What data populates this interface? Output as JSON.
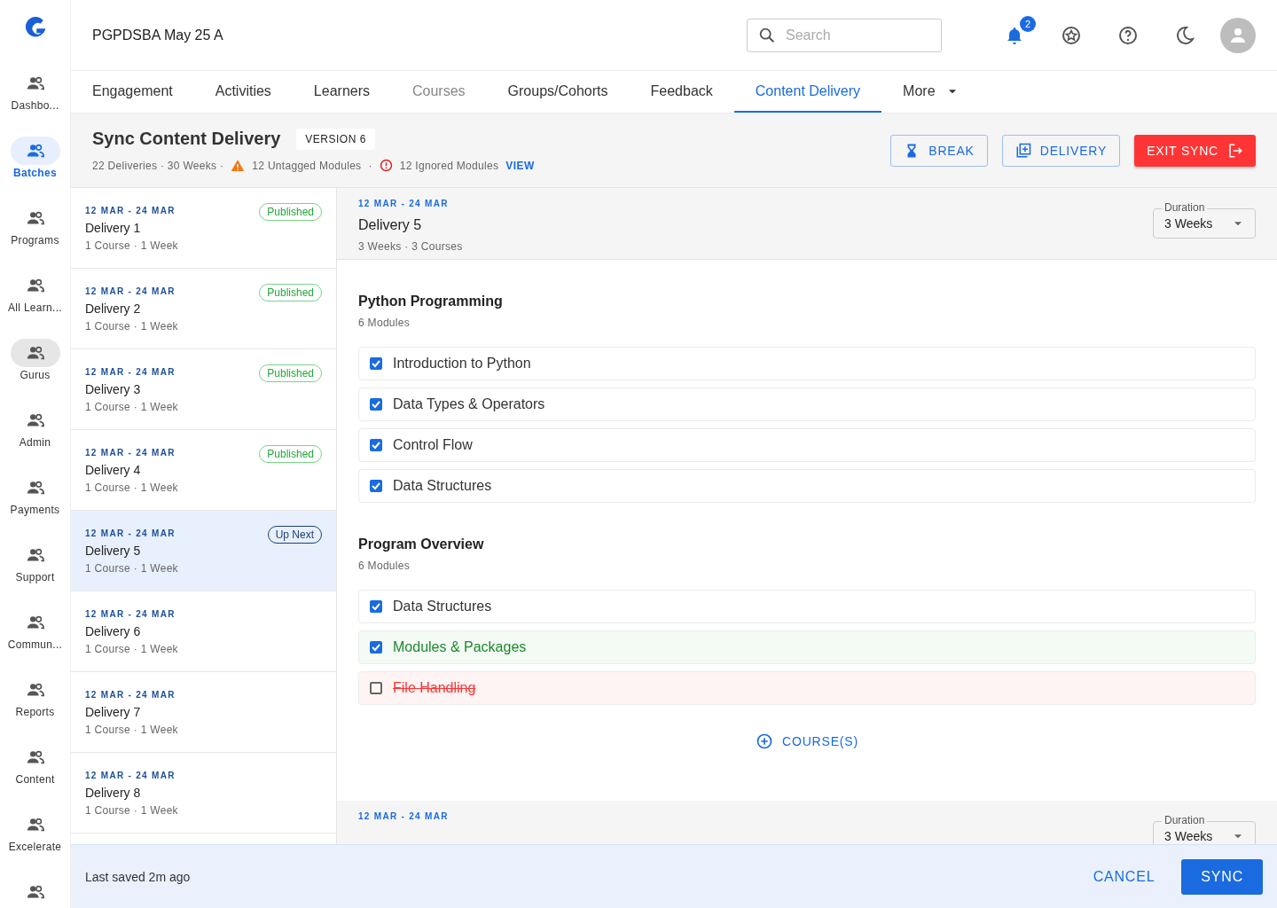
{
  "rail": [
    {
      "label": "Dashbo...",
      "selected": false,
      "hovered": false
    },
    {
      "label": "Batches",
      "selected": true,
      "hovered": false
    },
    {
      "label": "Programs",
      "selected": false,
      "hovered": false
    },
    {
      "label": "All Learn...",
      "selected": false,
      "hovered": false
    },
    {
      "label": "Gurus",
      "selected": false,
      "hovered": true
    },
    {
      "label": "Admin",
      "selected": false,
      "hovered": false
    },
    {
      "label": "Payments",
      "selected": false,
      "hovered": false
    },
    {
      "label": "Support",
      "selected": false,
      "hovered": false
    },
    {
      "label": "Commun...",
      "selected": false,
      "hovered": false
    },
    {
      "label": "Reports",
      "selected": false,
      "hovered": false
    },
    {
      "label": "Content",
      "selected": false,
      "hovered": false
    },
    {
      "label": "Excelerate",
      "selected": false,
      "hovered": false
    },
    {
      "selected": false,
      "hovered": false
    }
  ],
  "header": {
    "title": "PGPDSBA May 25 A",
    "search": {
      "placeholder": "Search"
    },
    "notifications": "2"
  },
  "tabs": [
    {
      "label": "Engagement",
      "selected": false,
      "disabled": false
    },
    {
      "label": "Activities",
      "selected": false,
      "disabled": false
    },
    {
      "label": "Learners",
      "selected": false,
      "disabled": false
    },
    {
      "label": "Courses",
      "selected": false,
      "disabled": true
    },
    {
      "label": "Groups/Cohorts",
      "selected": false,
      "disabled": false
    },
    {
      "label": "Feedback",
      "selected": false,
      "disabled": false
    },
    {
      "label": "Content Delivery",
      "selected": true,
      "disabled": false
    },
    {
      "label": "More",
      "selected": false,
      "disabled": false,
      "kind": "menu"
    }
  ],
  "page": {
    "title": "Sync Content Delivery",
    "version": "VERSION 6",
    "summary": "22 Deliveries · 30 Weeks ·",
    "untagged": "12 Untagged Modules",
    "separator": "·",
    "ignored": "12 Ignored Modules",
    "view": "VIEW",
    "buttons": [
      {
        "label": "BREAK",
        "kind": "break"
      },
      {
        "label": "DELIVERY",
        "kind": "delivery"
      },
      {
        "label": "EXIT SYNC",
        "kind": "exit"
      }
    ]
  },
  "deliveries": [
    {
      "dates": "12 MAR - 24 MAR",
      "name": "Delivery 1",
      "meta": "1 Course · 1 Week",
      "badge": "Published",
      "kind": "published",
      "selected": false
    },
    {
      "dates": "12 MAR - 24 MAR",
      "name": "Delivery 2",
      "meta": "1 Course · 1 Week",
      "badge": "Published",
      "kind": "published",
      "selected": false
    },
    {
      "dates": "12 MAR - 24 MAR",
      "name": "Delivery 3",
      "meta": "1 Course · 1 Week",
      "badge": "Published",
      "kind": "published",
      "selected": false
    },
    {
      "dates": "12 MAR - 24 MAR",
      "name": "Delivery 4",
      "meta": "1 Course · 1 Week",
      "badge": "Published",
      "kind": "published",
      "selected": false
    },
    {
      "dates": "12 MAR - 24 MAR",
      "name": "Delivery 5",
      "meta": "1 Course · 1 Week",
      "badge": "Up Next",
      "kind": "upnext",
      "selected": true
    },
    {
      "dates": "12 MAR - 24 MAR",
      "name": "Delivery 6",
      "meta": "1 Course · 1 Week",
      "selected": false
    },
    {
      "dates": "12 MAR - 24 MAR",
      "name": "Delivery 7",
      "meta": "1 Course · 1 Week",
      "selected": false
    },
    {
      "dates": "12 MAR - 24 MAR",
      "name": "Delivery 8",
      "meta": "1 Course · 1 Week",
      "selected": false
    }
  ],
  "detail": [
    {
      "dates": "12 MAR - 24 MAR",
      "title": "Delivery 5",
      "meta": "3 Weeks · 3 Courses",
      "duration": {
        "label": "Duration",
        "value": "3 Weeks"
      },
      "courses": [
        {
          "title": "Python Programming",
          "count": "6 Modules",
          "modules": [
            {
              "label": "Introduction to Python",
              "checked": true,
              "kind": "plain"
            },
            {
              "label": "Data Types & Operators",
              "checked": true,
              "kind": "plain"
            },
            {
              "label": "Control Flow",
              "checked": true,
              "kind": "plain"
            },
            {
              "label": "Data Structures",
              "checked": true,
              "kind": "plain"
            }
          ]
        },
        {
          "title": "Program Overview",
          "count": "6 Modules",
          "modules": [
            {
              "label": "Data Structures",
              "checked": true,
              "kind": "plain"
            },
            {
              "label": "Modules & Packages",
              "checked": true,
              "kind": "added"
            },
            {
              "label": "File Handling",
              "checked": false,
              "kind": "removed"
            }
          ]
        }
      ],
      "add_course": "COURSE(S)"
    },
    {
      "dates": "12 MAR - 24 MAR",
      "duration": {
        "label": "Duration",
        "value": "3 Weeks"
      }
    }
  ],
  "footer": {
    "saved": "Last saved 2m ago",
    "buttons": [
      {
        "label": "CANCEL",
        "kind": "text"
      },
      {
        "label": "SYNC",
        "kind": "primary"
      }
    ]
  }
}
